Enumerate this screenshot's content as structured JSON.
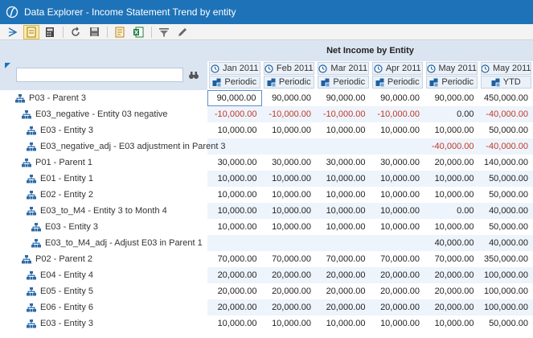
{
  "window": {
    "title": "Data Explorer - Income Statement Trend by entity"
  },
  "grid_title": "Net Income by Entity",
  "columns": [
    {
      "time": "Jan 2011",
      "view": "Periodic"
    },
    {
      "time": "Feb 2011",
      "view": "Periodic"
    },
    {
      "time": "Mar 2011",
      "view": "Periodic"
    },
    {
      "time": "Apr 2011",
      "view": "Periodic"
    },
    {
      "time": "May 2011",
      "view": "Periodic"
    },
    {
      "time": "May 2011",
      "view": "YTD"
    }
  ],
  "rows": [
    {
      "label": "P03 - Parent 3",
      "level": 0,
      "values": [
        "90,000.00",
        "90,000.00",
        "90,000.00",
        "90,000.00",
        "90,000.00",
        "450,000.00"
      ]
    },
    {
      "label": "E03_negative - Entity 03 negative",
      "level": 1,
      "values": [
        "-10,000.00",
        "-10,000.00",
        "-10,000.00",
        "-10,000.00",
        "0.00",
        "-40,000.00"
      ]
    },
    {
      "label": "E03 - Entity 3",
      "level": 2,
      "values": [
        "10,000.00",
        "10,000.00",
        "10,000.00",
        "10,000.00",
        "10,000.00",
        "50,000.00"
      ]
    },
    {
      "label": "E03_negative_adj - E03 adjustment in Parent 3",
      "level": 2,
      "values": [
        "",
        "",
        "",
        "",
        "-40,000.00",
        "-40,000.00"
      ]
    },
    {
      "label": "P01 - Parent 1",
      "level": 1,
      "values": [
        "30,000.00",
        "30,000.00",
        "30,000.00",
        "30,000.00",
        "20,000.00",
        "140,000.00"
      ]
    },
    {
      "label": "E01 - Entity 1",
      "level": 2,
      "values": [
        "10,000.00",
        "10,000.00",
        "10,000.00",
        "10,000.00",
        "10,000.00",
        "50,000.00"
      ]
    },
    {
      "label": "E02 - Entity 2",
      "level": 2,
      "values": [
        "10,000.00",
        "10,000.00",
        "10,000.00",
        "10,000.00",
        "10,000.00",
        "50,000.00"
      ]
    },
    {
      "label": "E03_to_M4 - Entity 3 to Month 4",
      "level": 2,
      "values": [
        "10,000.00",
        "10,000.00",
        "10,000.00",
        "10,000.00",
        "0.00",
        "40,000.00"
      ]
    },
    {
      "label": "E03 - Entity 3",
      "level": 3,
      "values": [
        "10,000.00",
        "10,000.00",
        "10,000.00",
        "10,000.00",
        "10,000.00",
        "50,000.00"
      ]
    },
    {
      "label": "E03_to_M4_adj - Adjust E03 in Parent 1",
      "level": 3,
      "values": [
        "",
        "",
        "",
        "",
        "40,000.00",
        "40,000.00"
      ]
    },
    {
      "label": "P02 - Parent 2",
      "level": 1,
      "values": [
        "70,000.00",
        "70,000.00",
        "70,000.00",
        "70,000.00",
        "70,000.00",
        "350,000.00"
      ]
    },
    {
      "label": "E04 - Entity 4",
      "level": 2,
      "values": [
        "20,000.00",
        "20,000.00",
        "20,000.00",
        "20,000.00",
        "20,000.00",
        "100,000.00"
      ]
    },
    {
      "label": "E05 - Entity 5",
      "level": 2,
      "values": [
        "20,000.00",
        "20,000.00",
        "20,000.00",
        "20,000.00",
        "20,000.00",
        "100,000.00"
      ]
    },
    {
      "label": "E06 - Entity 6",
      "level": 2,
      "values": [
        "20,000.00",
        "20,000.00",
        "20,000.00",
        "20,000.00",
        "20,000.00",
        "100,000.00"
      ]
    },
    {
      "label": "E03 - Entity 3",
      "level": 2,
      "values": [
        "10,000.00",
        "10,000.00",
        "10,000.00",
        "10,000.00",
        "10,000.00",
        "50,000.00"
      ]
    }
  ],
  "colors": {
    "titlebar": "#1e73b8",
    "negative": "#c0392b",
    "header_band": "#dbe5f1"
  },
  "icons": [
    "app-logo-icon",
    "collapse-icon",
    "active-doc-icon",
    "calculator-icon",
    "refresh-icon",
    "save-icon",
    "report-icon",
    "excel-icon",
    "filter-icon",
    "edit-icon",
    "binoculars-icon",
    "time-icon",
    "view-icon",
    "entity-hierarchy-icon"
  ]
}
